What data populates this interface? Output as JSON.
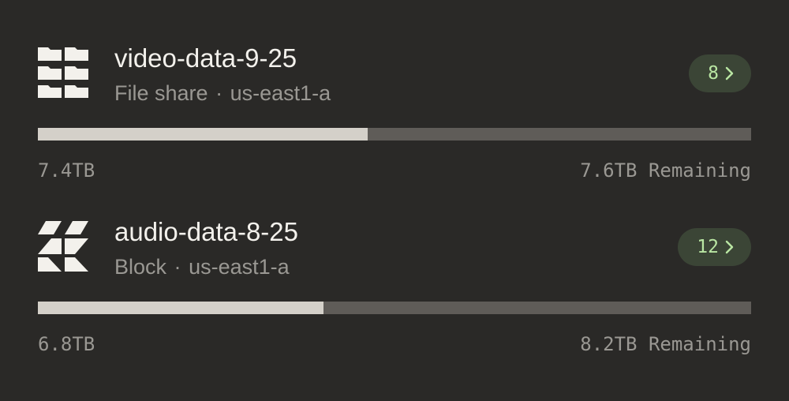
{
  "volumes": [
    {
      "name": "video-data-9-25",
      "type": "File share",
      "separator": "·",
      "zone": "us-east1-a",
      "count": "8",
      "used": "7.4TB",
      "remaining": "7.6TB Remaining",
      "used_fraction": 0.4625,
      "icon": "file-share-icon"
    },
    {
      "name": "audio-data-8-25",
      "type": "Block",
      "separator": "·",
      "zone": "us-east1-a",
      "count": "12",
      "used": "6.8TB",
      "remaining": "8.2TB Remaining",
      "used_fraction": 0.4,
      "icon": "block-storage-icon"
    }
  ],
  "colors": {
    "background": "#2a2927",
    "bar_used": "#d4d0c9",
    "bar_remaining": "#5f5c58",
    "pill_background": "#3b4536",
    "pill_text": "#b9e6a3"
  }
}
